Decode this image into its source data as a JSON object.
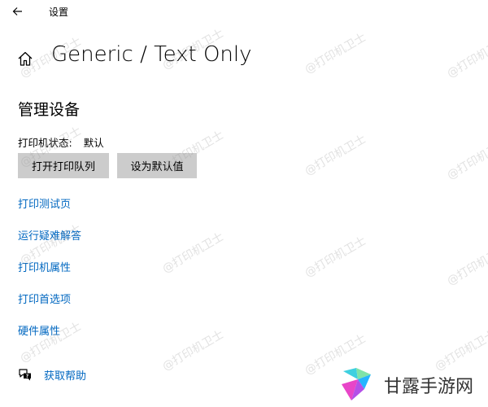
{
  "window": {
    "app_title": "设置"
  },
  "page": {
    "title": "Generic / Text Only"
  },
  "section": {
    "title": "管理设备"
  },
  "status": {
    "label": "打印机状态:",
    "value": "默认"
  },
  "buttons": {
    "open_queue": "打开打印队列",
    "set_default": "设为默认值"
  },
  "links": [
    "打印测试页",
    "运行疑难解答",
    "打印机属性",
    "打印首选项",
    "硬件属性"
  ],
  "help": {
    "label": "获取帮助"
  },
  "watermark": {
    "text": "@打印机卫士"
  },
  "brand": {
    "text": "甘露手游网"
  },
  "colors": {
    "link": "#0067c0",
    "button_bg": "#cccccc",
    "background": "#ffffff"
  },
  "icons": {
    "back": "arrow-left-icon",
    "home": "home-icon",
    "help": "help-chat-icon"
  }
}
